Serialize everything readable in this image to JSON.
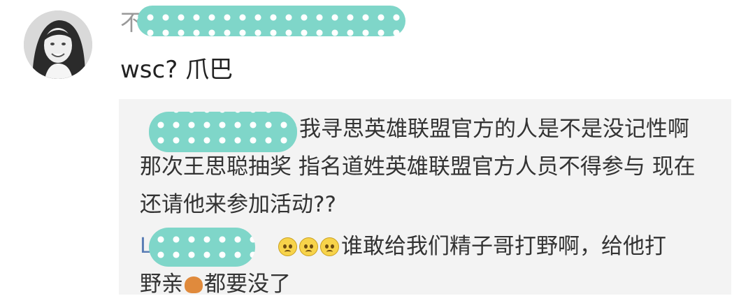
{
  "comment": {
    "username_visible": "不",
    "text": "wsc? 爪巴"
  },
  "replies": [
    {
      "user_stub": "",
      "text": "我寻思英雄联盟官方的人是不是没记性啊 那次王思聪抽奖 指名道姓英雄联盟官方人员不得参与 现在还请他来参加活动??"
    },
    {
      "user_stub": "L",
      "emoji": [
        "worried-face-icon",
        "worried-face-icon",
        "worried-face-icon"
      ],
      "text_after_emoji": "谁敢给我们精子哥打野啊，给他打",
      "text_line2_start": "野亲",
      "emoji2": "pig-face-icon",
      "text_line2_end": "都要没了"
    }
  ],
  "colors": {
    "mask": "#7fd6c9",
    "reply_bg": "#f3f3f3",
    "username_link": "#5a7db5"
  }
}
